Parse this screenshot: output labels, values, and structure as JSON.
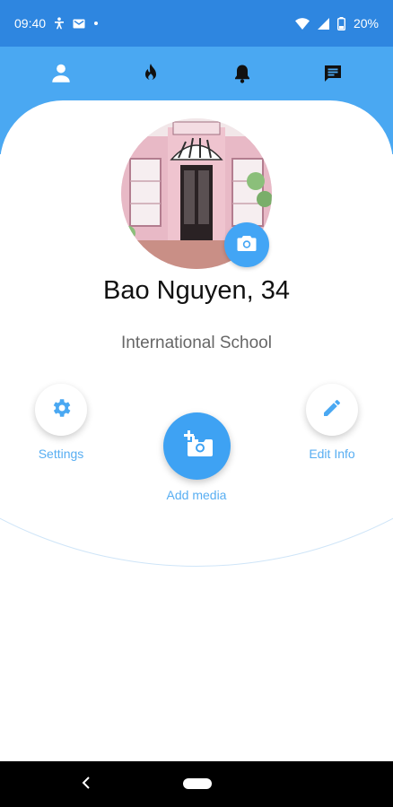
{
  "status_bar": {
    "time": "09:40",
    "battery": "20%",
    "icons": [
      "accessibility-icon",
      "mail-icon",
      "dot-icon",
      "wifi-icon",
      "signal-icon",
      "battery-icon"
    ]
  },
  "top_nav": {
    "tabs": [
      {
        "id": "profile",
        "icon": "person-icon",
        "selected": true
      },
      {
        "id": "discover",
        "icon": "flame-icon",
        "selected": false
      },
      {
        "id": "notifications",
        "icon": "bell-icon",
        "selected": false
      },
      {
        "id": "messages",
        "icon": "chat-icon",
        "selected": false
      }
    ]
  },
  "profile": {
    "name": "Bao Nguyen, 34",
    "school": "International School",
    "avatar_icon": "shopfront-photo",
    "camera_icon": "camera-icon"
  },
  "actions": {
    "settings_label": "Settings",
    "edit_label": "Edit Info",
    "add_media_label": "Add media"
  },
  "colors": {
    "primary": "#4aa8f2",
    "status_bar": "#2e86e0",
    "accent_text": "#58aef2",
    "name_text": "#111111",
    "school_text": "#666666"
  },
  "system_nav": {
    "back_icon": "back-chevron-icon",
    "home_icon": "home-pill-icon"
  }
}
